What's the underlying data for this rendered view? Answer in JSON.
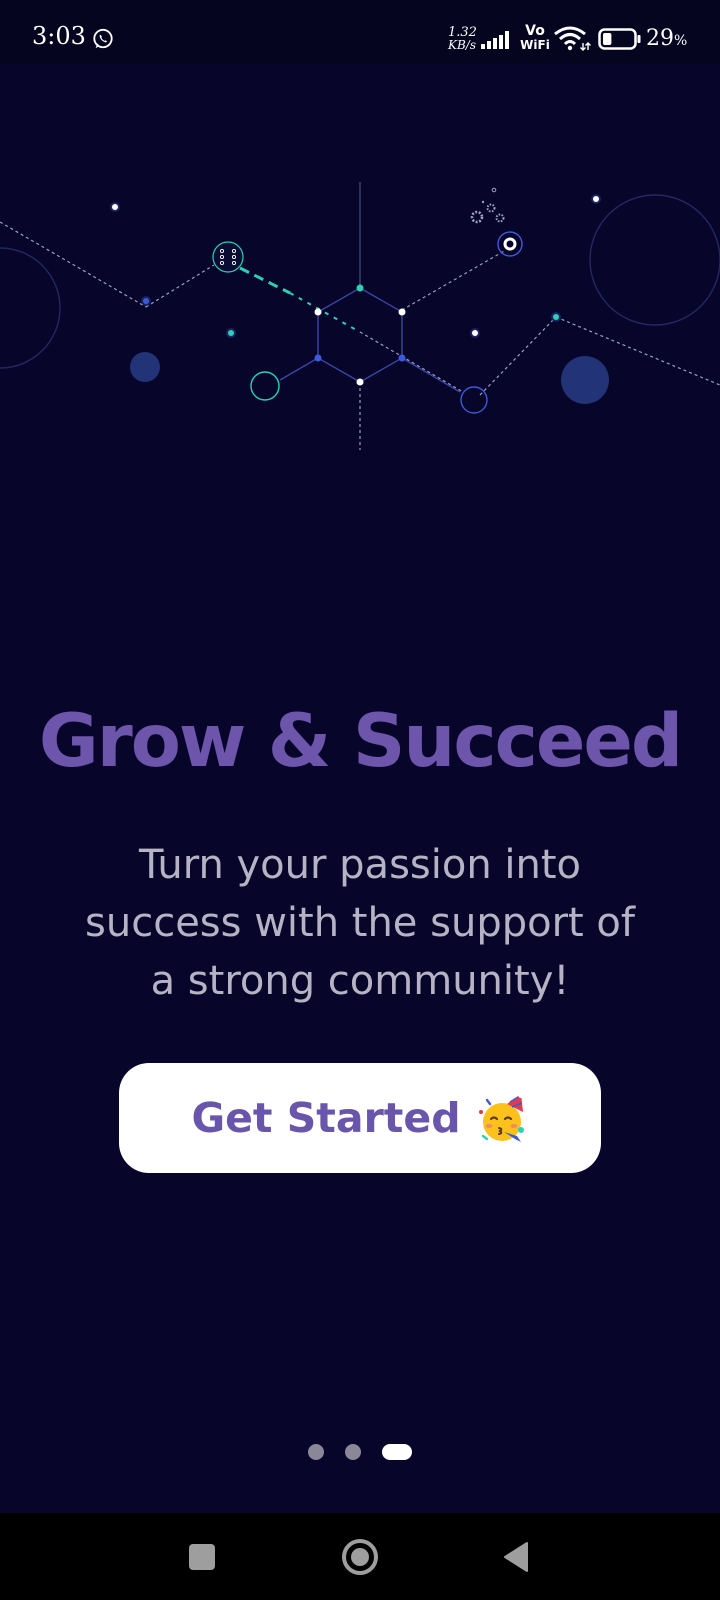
{
  "status_bar": {
    "time": "3:03",
    "network_speed_value": "1.32",
    "network_speed_unit": "KB/s",
    "vowifi_top": "Vo",
    "vowifi_bottom": "WiFi",
    "battery_value": "29",
    "battery_unit": "%",
    "battery_level": 0.29,
    "icons": [
      "whatsapp-icon",
      "signal-bars-icon",
      "wifi-icon",
      "battery-icon"
    ]
  },
  "onboarding": {
    "title": "Grow & Succeed",
    "subtitle": "Turn your passion into success with the support of a strong community!",
    "cta_label": "Get Started",
    "cta_icon": "party-face-emoji",
    "page_count": 3,
    "active_page": 3
  },
  "nav_bar": {
    "icons": [
      "recent-apps-icon",
      "home-icon",
      "back-icon"
    ]
  },
  "colors": {
    "background": "#07062a",
    "title": "#6d55ab",
    "subtitle": "#b6b4c4",
    "button_bg": "#ffffff",
    "button_text": "#6a55ad",
    "accent_teal": "#2bd1b5",
    "accent_blue": "#3d5bd9"
  }
}
